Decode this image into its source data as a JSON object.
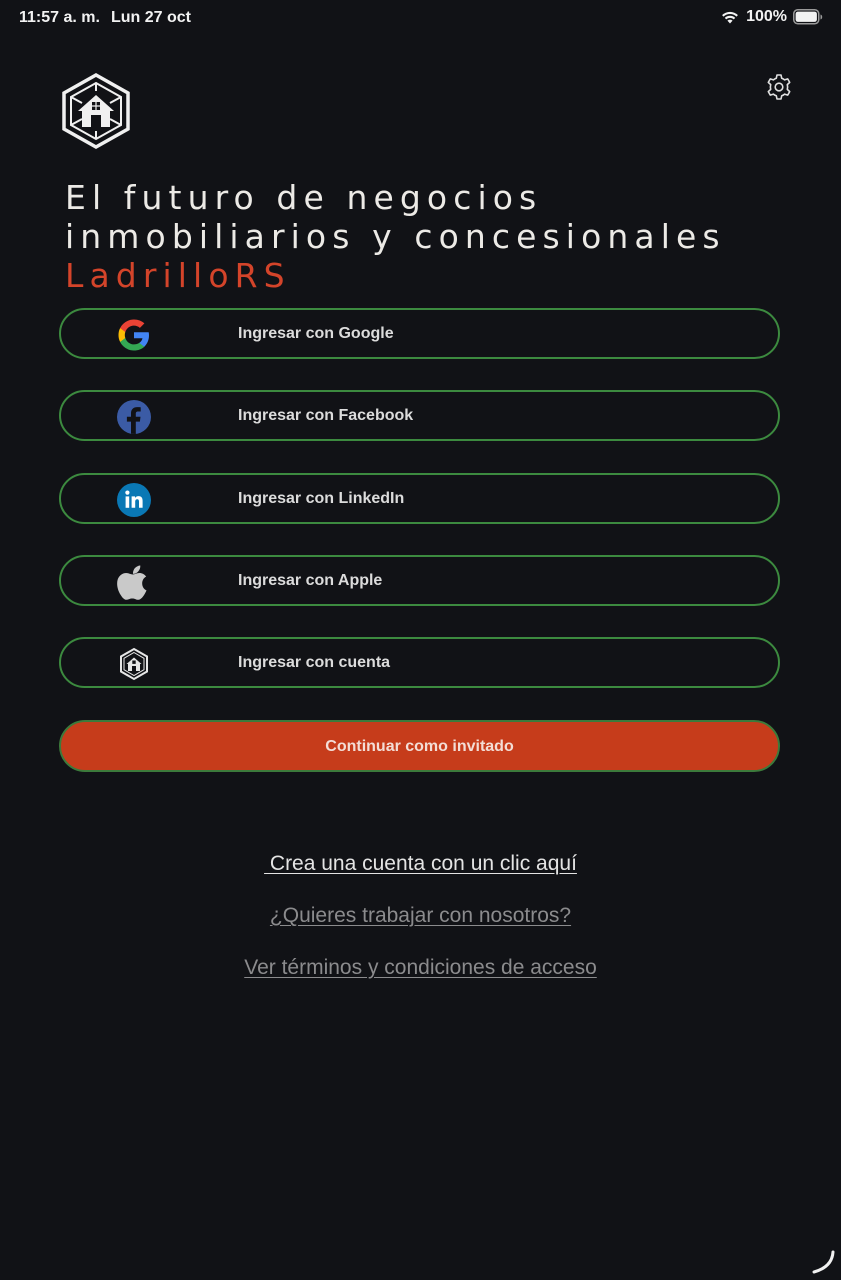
{
  "status_bar": {
    "time": "11:57 a. m.",
    "date": "Lun 27 oct",
    "battery": "100%"
  },
  "header": {
    "logo_icon": "house-hexagon-logo-icon",
    "settings_icon": "gear-icon"
  },
  "headline": {
    "text": "El futuro de negocios inmobiliarios y concesionales ",
    "brand": "LadrilloRS"
  },
  "login_options": [
    {
      "label": "Ingresar con Google",
      "icon": "google-icon"
    },
    {
      "label": "Ingresar con Facebook",
      "icon": "facebook-icon"
    },
    {
      "label": "Ingresar con LinkedIn",
      "icon": "linkedin-icon"
    },
    {
      "label": "Ingresar con Apple",
      "icon": "apple-icon"
    },
    {
      "label": "Ingresar con cuenta",
      "icon": "ladrillors-logo-icon"
    }
  ],
  "guest_button": {
    "label": "Continuar como invitado"
  },
  "links": {
    "create_account": " Crea una cuenta con un clic aquí",
    "work_with_us": "¿Quieres trabajar con nosotros?",
    "terms": "Ver términos y condiciones de acceso"
  },
  "colors": {
    "background": "#111216",
    "accent_brand": "#d4442a",
    "guest_button": "#c63c1b",
    "button_border": "#3c8a3f"
  }
}
